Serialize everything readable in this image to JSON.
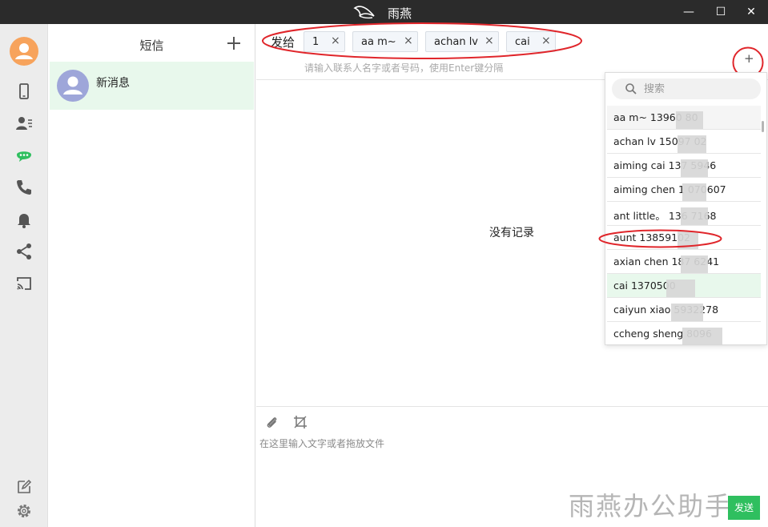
{
  "window": {
    "title": "雨燕",
    "minimize": "—",
    "maximize": "☐",
    "close": "✕"
  },
  "rail": {
    "icons": [
      "avatar-icon",
      "phone-device-icon",
      "contacts-icon",
      "messages-icon",
      "call-icon",
      "notification-bell-icon",
      "share-icon",
      "cast-icon",
      "edit-icon",
      "settings-gear-icon"
    ],
    "active_color": "#2fbf5f"
  },
  "conversations": {
    "title": "短信",
    "items": [
      {
        "name": "新消息"
      }
    ]
  },
  "compose_header": {
    "send_to_label": "发给",
    "recipients": [
      {
        "label": "1",
        "remove": "×"
      },
      {
        "label": "aa m~",
        "remove": "×"
      },
      {
        "label": "achan lv",
        "remove": "×"
      },
      {
        "label": "cai",
        "remove": "×"
      }
    ],
    "hint": "请输入联系人名字或者号码，使用Enter键分隔",
    "add_button_label": "+"
  },
  "conversation_view": {
    "empty_text": "没有记录"
  },
  "composer": {
    "placeholder": "在这里输入文字或者拖放文件",
    "send_label": "发送",
    "watermark": "雨燕办公助手"
  },
  "contact_dropdown": {
    "search_placeholder": "搜索",
    "contacts": [
      {
        "label": "aa m~ 13960      80",
        "state": "hover"
      },
      {
        "label": "achan lv 15097      02",
        "state": "normal"
      },
      {
        "label": "aiming cai 137      5946",
        "state": "normal"
      },
      {
        "label": "aiming chen 1      070607",
        "state": "normal"
      },
      {
        "label": "ant little。 136      7168",
        "state": "normal"
      },
      {
        "label": "aunt 13859102",
        "state": "normal"
      },
      {
        "label": "axian chen 187      6241",
        "state": "normal"
      },
      {
        "label": "cai 1370500",
        "state": "selected"
      },
      {
        "label": "caiyun xiao      5932278",
        "state": "normal"
      },
      {
        "label": "ccheng sheng            8096",
        "state": "normal"
      }
    ]
  },
  "annotation_color": "#e0262b"
}
